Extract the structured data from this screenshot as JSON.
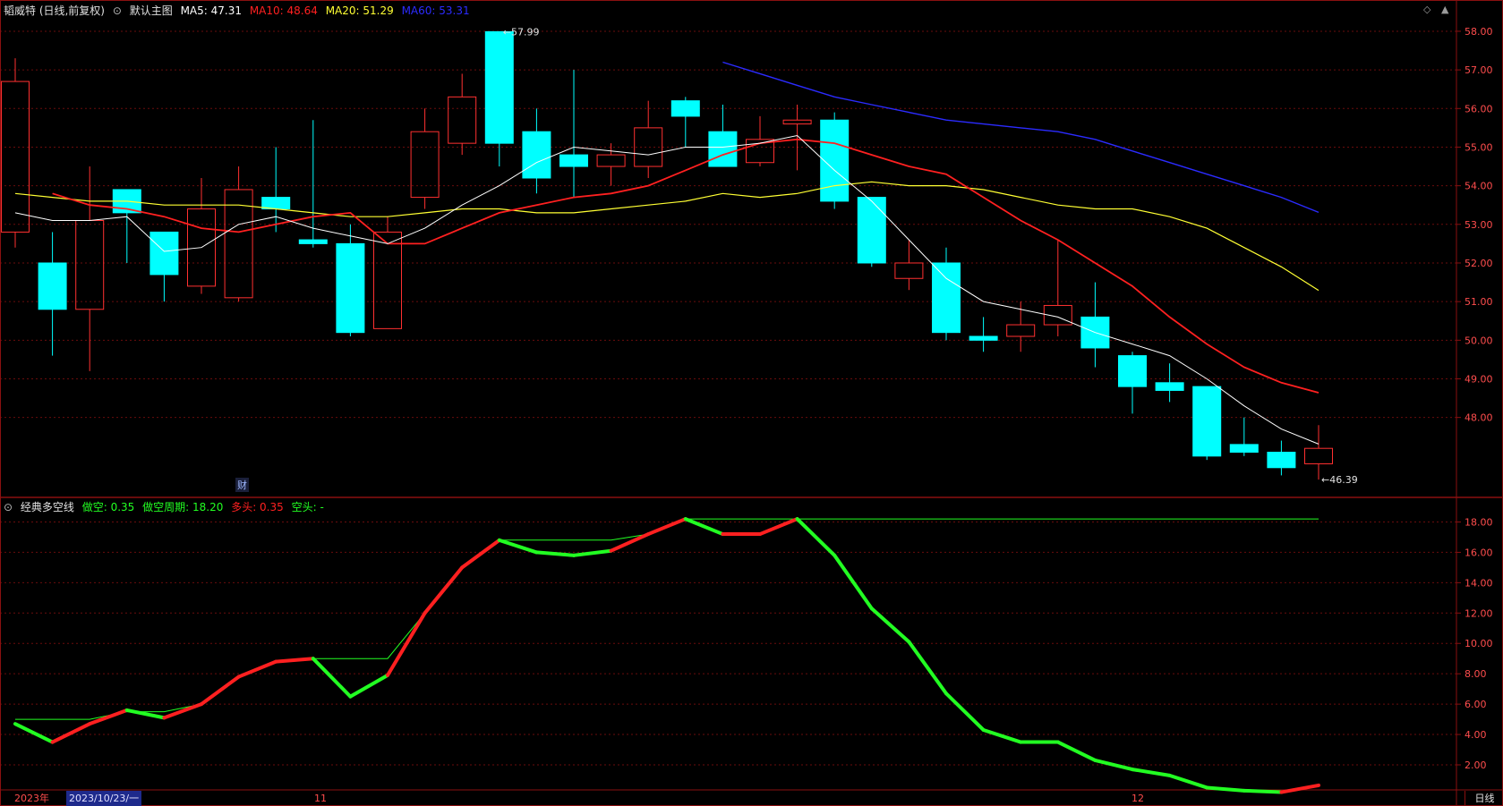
{
  "header": {
    "stock": "韬威特 (日线,前复权)",
    "template": "默认主图",
    "ma5": {
      "label": "MA5: 47.31",
      "color": "#ffffff"
    },
    "ma10": {
      "label": "MA10: 48.64",
      "color": "#ff2020"
    },
    "ma20": {
      "label": "MA20: 51.29",
      "color": "#ffff33"
    },
    "ma60": {
      "label": "MA60: 53.31",
      "color": "#2b2bff"
    }
  },
  "indicator_header": {
    "name": "经典多空线",
    "bull_label": "做空: 0.35",
    "period_label": "做空周期: 18.20",
    "long_label": "多头: 0.35",
    "short_label": "空头: -"
  },
  "badge": "财",
  "timebar": {
    "year": "2023年",
    "date": "2023/10/23/一",
    "month11": "11",
    "month12": "12",
    "period": "日线"
  },
  "colors": {
    "bg": "#000000",
    "frame": "#8a1010",
    "grid": "#6a0c0c",
    "up": "#ff3030",
    "down": "#00ffff",
    "ma5": "#ffffff",
    "ma10": "#ff2020",
    "ma20": "#ffff33",
    "ma60": "#2b2bff",
    "ind_green": "#22ff22",
    "ind_red": "#ff2020",
    "axis_text": "#ff4d4d"
  },
  "chart_data": [
    {
      "type": "candlestick",
      "ylim": [
        46.0,
        58.3
      ],
      "yticks": [
        48.0,
        49.0,
        50.0,
        51.0,
        52.0,
        53.0,
        54.0,
        55.0,
        56.0,
        57.0,
        58.0
      ],
      "max_label": "57.99",
      "min_label": "46.39",
      "candles": [
        {
          "o": 52.8,
          "h": 57.3,
          "l": 52.4,
          "c": 56.7
        },
        {
          "o": 52.0,
          "h": 52.8,
          "l": 49.6,
          "c": 50.8
        },
        {
          "o": 50.8,
          "h": 54.5,
          "l": 49.2,
          "c": 53.1
        },
        {
          "o": 53.9,
          "h": 53.9,
          "l": 52.0,
          "c": 53.3
        },
        {
          "o": 52.8,
          "h": 52.8,
          "l": 51.0,
          "c": 51.7
        },
        {
          "o": 51.4,
          "h": 54.2,
          "l": 51.2,
          "c": 53.4
        },
        {
          "o": 51.1,
          "h": 54.5,
          "l": 51.0,
          "c": 53.9
        },
        {
          "o": 53.7,
          "h": 55.0,
          "l": 52.8,
          "c": 53.4
        },
        {
          "o": 52.6,
          "h": 55.7,
          "l": 52.4,
          "c": 52.5
        },
        {
          "o": 52.5,
          "h": 53.0,
          "l": 50.1,
          "c": 50.2
        },
        {
          "o": 50.3,
          "h": 53.2,
          "l": 50.3,
          "c": 52.8
        },
        {
          "o": 53.7,
          "h": 56.0,
          "l": 53.4,
          "c": 55.4
        },
        {
          "o": 55.1,
          "h": 56.9,
          "l": 54.8,
          "c": 56.3
        },
        {
          "o": 57.99,
          "h": 57.99,
          "l": 54.5,
          "c": 55.1
        },
        {
          "o": 55.4,
          "h": 56.0,
          "l": 53.8,
          "c": 54.2
        },
        {
          "o": 54.8,
          "h": 57.0,
          "l": 53.7,
          "c": 54.5
        },
        {
          "o": 54.5,
          "h": 55.1,
          "l": 54.0,
          "c": 54.8
        },
        {
          "o": 54.5,
          "h": 56.2,
          "l": 54.2,
          "c": 55.5
        },
        {
          "o": 56.2,
          "h": 56.3,
          "l": 55.0,
          "c": 55.8
        },
        {
          "o": 55.4,
          "h": 56.1,
          "l": 54.5,
          "c": 54.5
        },
        {
          "o": 54.6,
          "h": 55.8,
          "l": 54.5,
          "c": 55.2
        },
        {
          "o": 55.6,
          "h": 56.1,
          "l": 54.4,
          "c": 55.7
        },
        {
          "o": 55.7,
          "h": 55.9,
          "l": 53.4,
          "c": 53.6
        },
        {
          "o": 53.7,
          "h": 53.7,
          "l": 51.9,
          "c": 52.0
        },
        {
          "o": 51.6,
          "h": 52.6,
          "l": 51.3,
          "c": 52.0
        },
        {
          "o": 52.0,
          "h": 52.4,
          "l": 50.0,
          "c": 50.2
        },
        {
          "o": 50.1,
          "h": 50.6,
          "l": 49.7,
          "c": 50.0
        },
        {
          "o": 50.1,
          "h": 51.0,
          "l": 49.7,
          "c": 50.4
        },
        {
          "o": 50.4,
          "h": 52.6,
          "l": 50.1,
          "c": 50.9
        },
        {
          "o": 50.6,
          "h": 51.5,
          "l": 49.3,
          "c": 49.8
        },
        {
          "o": 49.6,
          "h": 49.7,
          "l": 48.1,
          "c": 48.8
        },
        {
          "o": 48.9,
          "h": 49.4,
          "l": 48.4,
          "c": 48.7
        },
        {
          "o": 48.8,
          "h": 48.8,
          "l": 46.9,
          "c": 47.0
        },
        {
          "o": 47.3,
          "h": 48.0,
          "l": 47.0,
          "c": 47.1
        },
        {
          "o": 47.1,
          "h": 47.4,
          "l": 46.5,
          "c": 46.7
        },
        {
          "o": 46.8,
          "h": 47.8,
          "l": 46.39,
          "c": 47.2
        }
      ],
      "ma5": [
        53.3,
        53.1,
        53.1,
        53.2,
        52.3,
        52.4,
        53.0,
        53.2,
        52.9,
        52.7,
        52.5,
        52.9,
        53.5,
        54.0,
        54.6,
        55.0,
        54.9,
        54.8,
        55.0,
        55.0,
        55.1,
        55.3,
        54.4,
        53.6,
        52.6,
        51.6,
        51.0,
        50.8,
        50.6,
        50.2,
        49.9,
        49.6,
        49.0,
        48.3,
        47.7,
        47.31
      ],
      "ma10": [
        53.8,
        53.5,
        53.4,
        53.2,
        52.9,
        52.8,
        53.0,
        53.2,
        53.3,
        52.5,
        52.5,
        52.9,
        53.3,
        53.5,
        53.7,
        53.8,
        54.0,
        54.4,
        54.8,
        55.1,
        55.2,
        55.1,
        54.8,
        54.5,
        54.3,
        53.7,
        53.1,
        52.6,
        52.0,
        51.4,
        50.6,
        49.9,
        49.3,
        48.9,
        48.64
      ],
      "ma20": [
        53.8,
        53.7,
        53.6,
        53.6,
        53.5,
        53.5,
        53.5,
        53.4,
        53.3,
        53.2,
        53.2,
        53.3,
        53.4,
        53.4,
        53.3,
        53.3,
        53.4,
        53.5,
        53.6,
        53.8,
        53.7,
        53.8,
        54.0,
        54.1,
        54.0,
        54.0,
        53.9,
        53.7,
        53.5,
        53.4,
        53.4,
        53.2,
        52.9,
        52.4,
        51.9,
        51.29
      ],
      "ma60": [
        57.2,
        56.9,
        56.6,
        56.3,
        56.1,
        55.9,
        55.7,
        55.6,
        55.5,
        55.4,
        55.2,
        54.9,
        54.6,
        54.3,
        54.0,
        53.7,
        53.31
      ]
    },
    {
      "type": "line",
      "title": "经典多空线",
      "ylim": [
        0.35,
        18.5
      ],
      "yticks": [
        2.0,
        4.0,
        6.0,
        8.0,
        10.0,
        12.0,
        14.0,
        16.0,
        18.0
      ],
      "signal": [
        4.7,
        3.5,
        4.7,
        5.6,
        5.1,
        6.0,
        7.8,
        8.8,
        9.0,
        6.5,
        7.9,
        12.0,
        15.0,
        16.8,
        16.0,
        15.8,
        16.1,
        17.2,
        18.2,
        17.2,
        17.2,
        18.2,
        15.8,
        12.3,
        10.1,
        6.7,
        4.3,
        3.5,
        3.5,
        2.3,
        1.7,
        1.3,
        0.5,
        0.3,
        0.2,
        0.65
      ],
      "signal_colors": [
        "g",
        "g",
        "r",
        "r",
        "g",
        "r",
        "r",
        "r",
        "r",
        "g",
        "g",
        "r",
        "r",
        "r",
        "g",
        "g",
        "g",
        "r",
        "r",
        "g",
        "r",
        "r",
        "g",
        "g",
        "g",
        "g",
        "g",
        "g",
        "g",
        "g",
        "g",
        "g",
        "g",
        "g",
        "g",
        "r"
      ],
      "ref_line": [
        5.0,
        5.0,
        5.0,
        5.5,
        5.5,
        6.0,
        7.8,
        8.8,
        9.0,
        9.0,
        9.0,
        12.0,
        15.0,
        16.8,
        16.8,
        16.8,
        16.8,
        17.2,
        18.2,
        18.2,
        18.2,
        18.2,
        18.2,
        18.2,
        18.2,
        18.2,
        18.2,
        18.2,
        18.2,
        18.2,
        18.2,
        18.2,
        18.2,
        18.2,
        18.2,
        18.2
      ]
    }
  ]
}
